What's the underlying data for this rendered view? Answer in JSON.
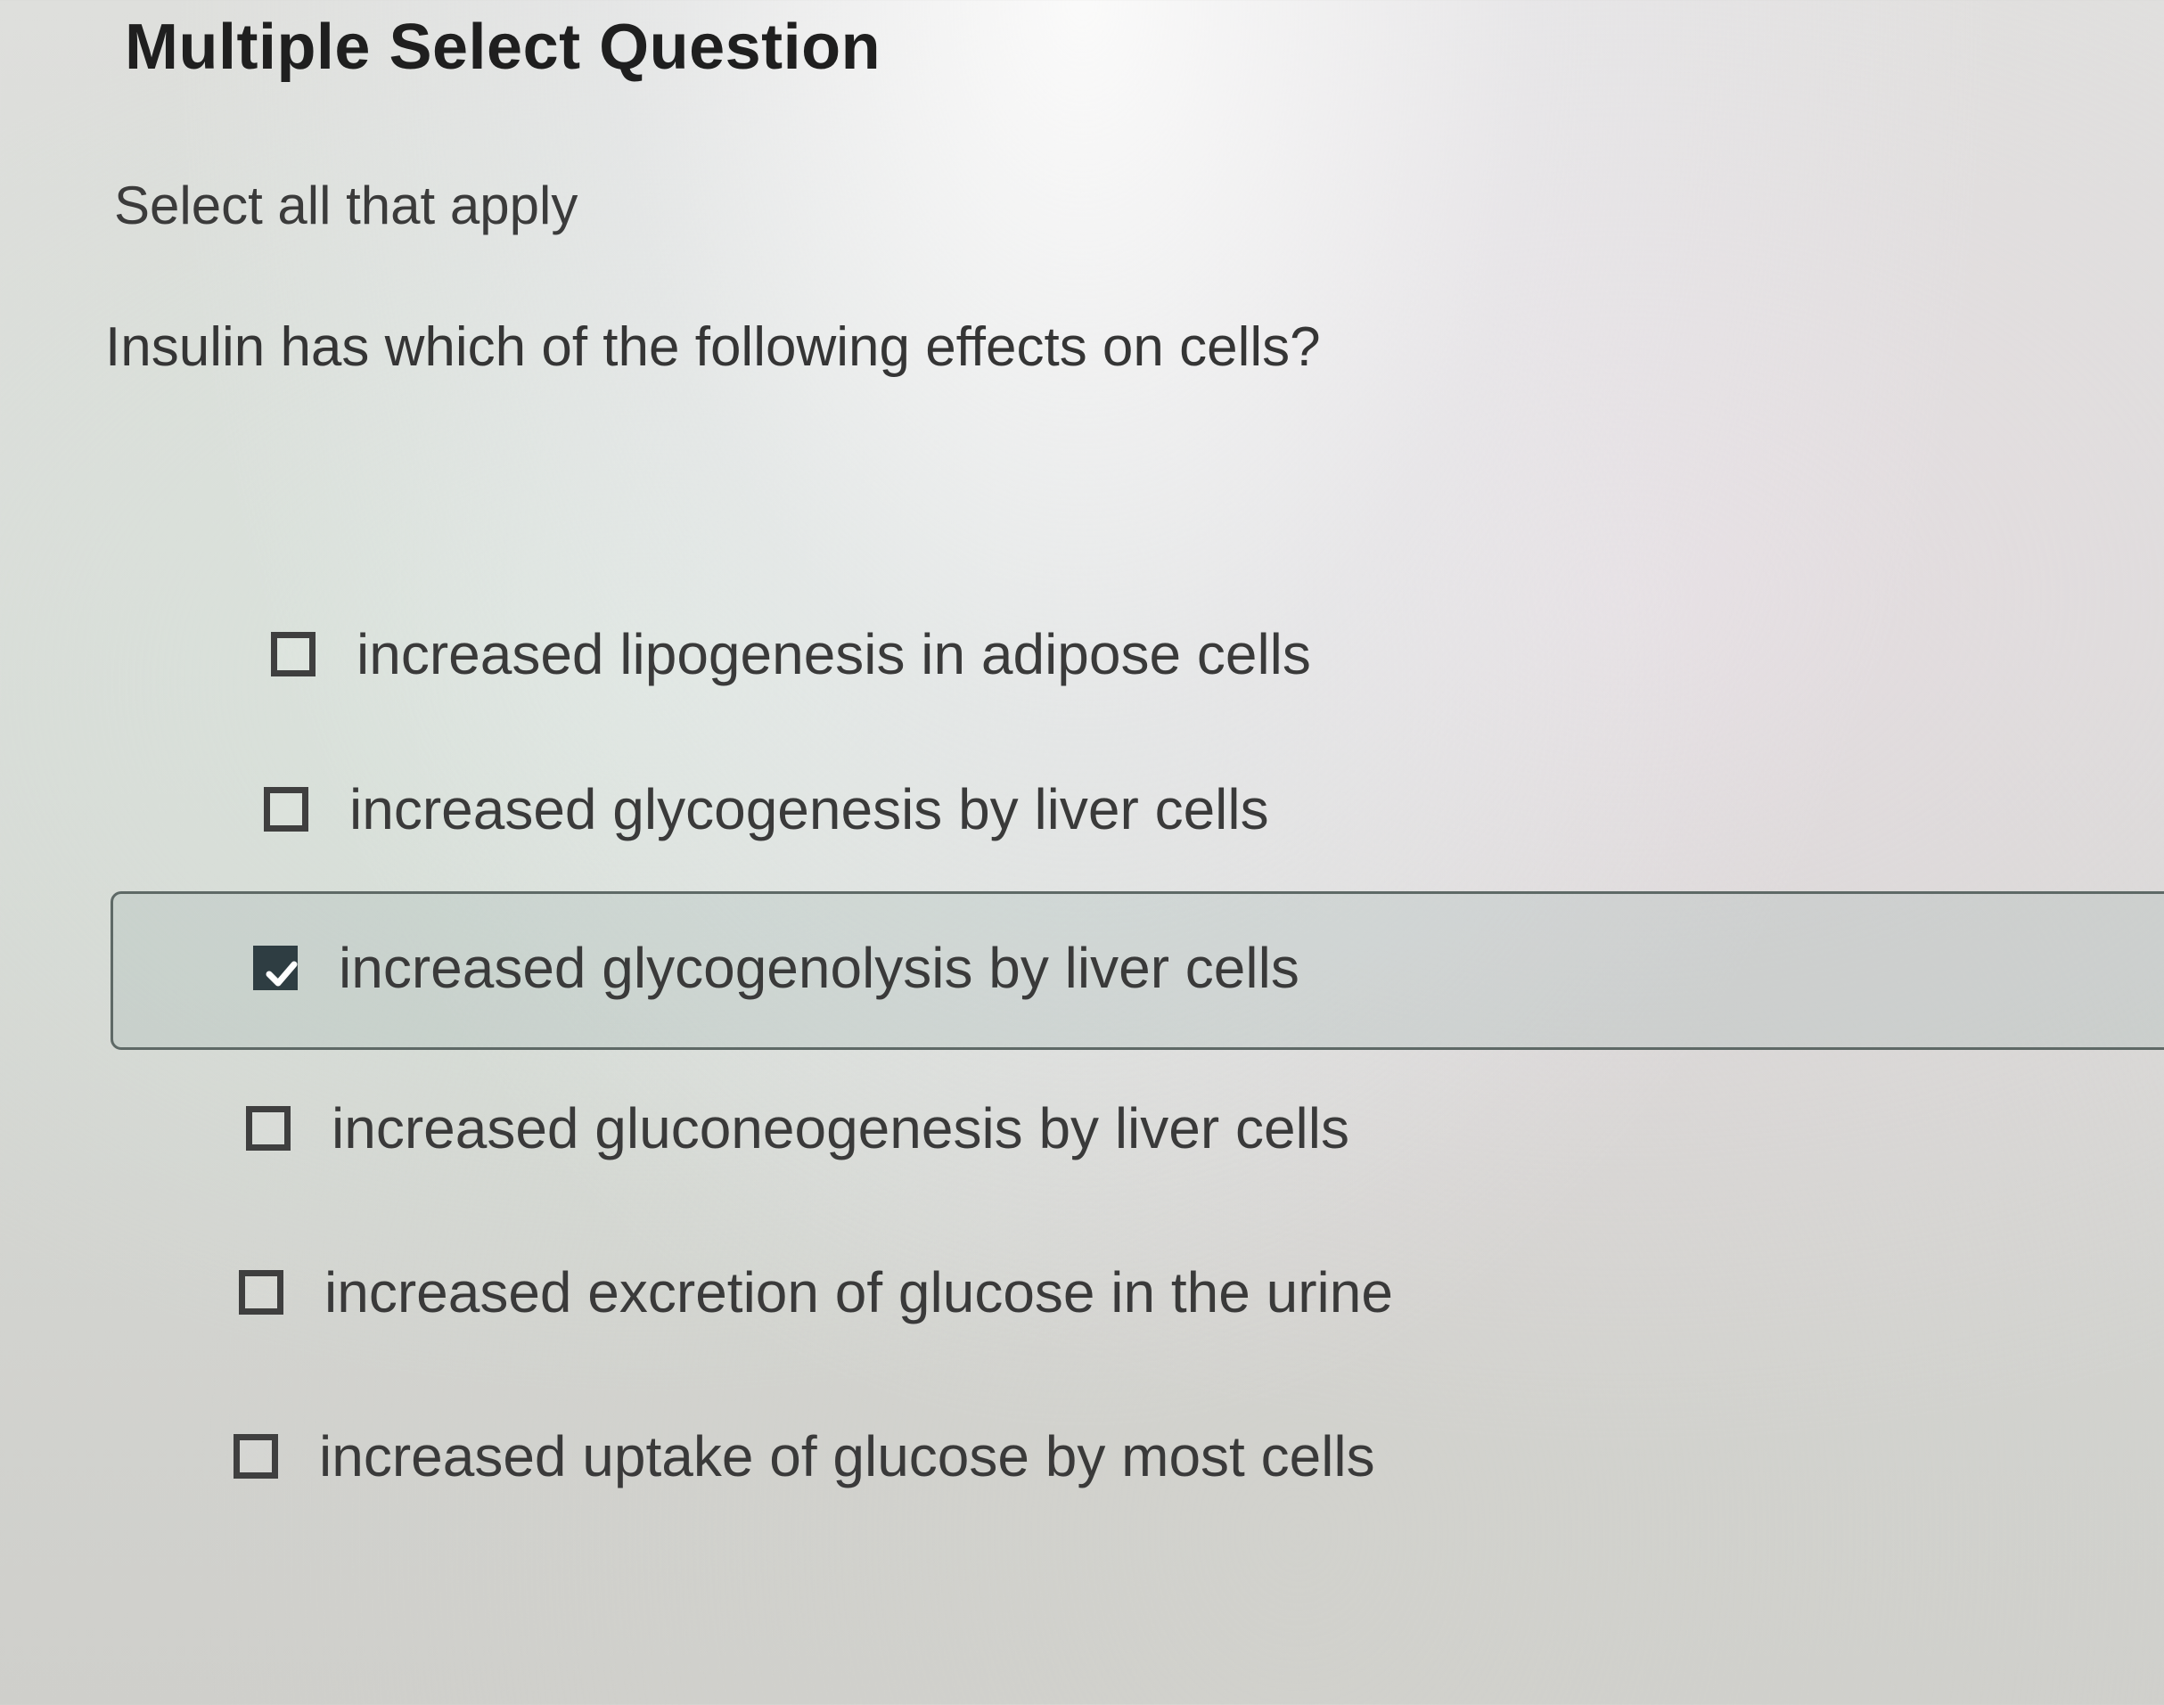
{
  "header": {
    "title": "Multiple Select Question"
  },
  "question": {
    "instruction": "Select all that apply",
    "prompt": "Insulin has which of the following effects on cells?"
  },
  "options": [
    {
      "label": "increased lipogenesis in adipose cells",
      "checked": false
    },
    {
      "label": "increased glycogenesis by liver cells",
      "checked": false
    },
    {
      "label": "increased glycogenolysis by liver cells",
      "checked": true
    },
    {
      "label": "increased gluconeogenesis by liver cells",
      "checked": false
    },
    {
      "label": "increased excretion of glucose in the urine",
      "checked": false
    },
    {
      "label": "increased uptake of glucose by most cells",
      "checked": false
    }
  ],
  "icons": {
    "checkmark": "checkmark-icon"
  },
  "colors": {
    "selected_fill": "#2e3d42",
    "checkbox_border": "#3f3f3f"
  }
}
